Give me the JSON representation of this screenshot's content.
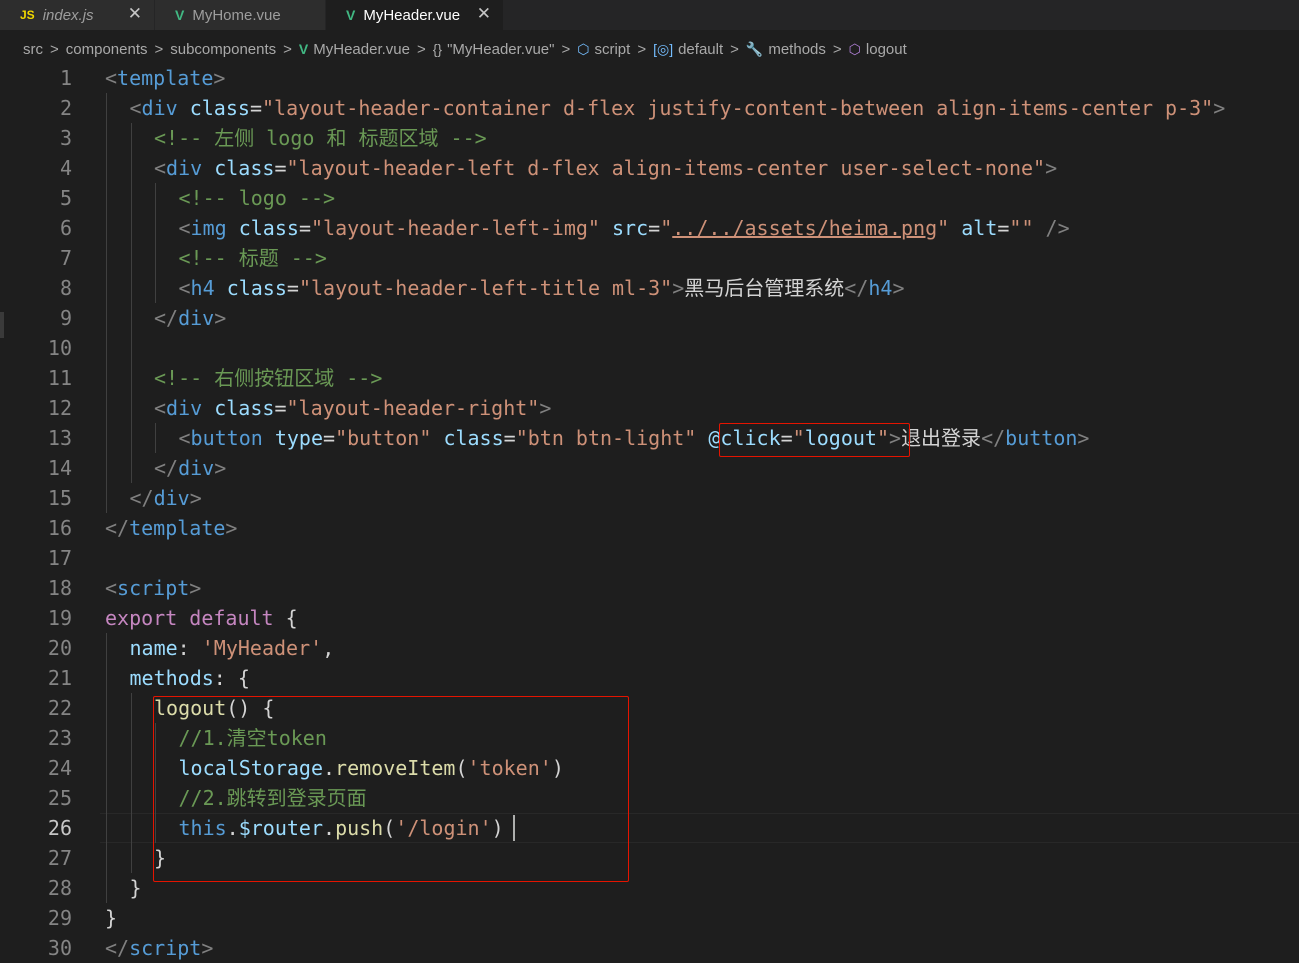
{
  "tabs": [
    {
      "icon": "JS",
      "icon_name": "js-file-icon",
      "label": "index.js",
      "active": false,
      "italic": true,
      "close": "✕"
    },
    {
      "icon": "V",
      "icon_name": "vue-file-icon",
      "label": "MyHome.vue",
      "active": false,
      "italic": false,
      "close": ""
    },
    {
      "icon": "V",
      "icon_name": "vue-file-icon",
      "label": "MyHeader.vue",
      "active": true,
      "italic": false,
      "close": "✕"
    }
  ],
  "breadcrumb": [
    {
      "icon": "",
      "label": "src"
    },
    {
      "icon": "",
      "label": "components"
    },
    {
      "icon": "",
      "label": "subcomponents"
    },
    {
      "icon": "V",
      "icon_name": "vue-file-icon",
      "label": "MyHeader.vue"
    },
    {
      "icon": "{}",
      "icon_name": "braces-icon",
      "label": "\"MyHeader.vue\""
    },
    {
      "icon": "⬡",
      "icon_name": "symbol-module-icon",
      "label": "script"
    },
    {
      "icon": "[◎]",
      "icon_name": "symbol-variable-icon",
      "label": "default"
    },
    {
      "icon": "🔧",
      "icon_name": "symbol-method-icon",
      "label": "methods"
    },
    {
      "icon": "⬡",
      "icon_name": "symbol-method-cube-icon",
      "label": "logout"
    }
  ],
  "breadcrumb_separator": ">",
  "colors": {
    "background": "#1e1e1e",
    "tag": "#569cd6",
    "attribute": "#9cdcfe",
    "string": "#ce9178",
    "comment": "#6a9955",
    "keyword": "#c586c0",
    "function": "#dcdcaa",
    "highlight_box": "#e51400"
  },
  "current_line": 26,
  "lines": [
    {
      "n": "1",
      "indent": 0,
      "tokens": [
        [
          "t-punc",
          "<"
        ],
        [
          "t-tag",
          "template"
        ],
        [
          "t-punc",
          ">"
        ]
      ]
    },
    {
      "n": "2",
      "indent": 1,
      "tokens": [
        [
          "t-punc",
          "<"
        ],
        [
          "t-tag",
          "div"
        ],
        [
          "t-plain",
          " "
        ],
        [
          "t-attr",
          "class"
        ],
        [
          "t-plain",
          "="
        ],
        [
          "t-str",
          "\"layout-header-container d-flex justify-content-between align-items-center p-3\""
        ],
        [
          "t-punc",
          ">"
        ]
      ]
    },
    {
      "n": "3",
      "indent": 2,
      "tokens": [
        [
          "t-cmt",
          "<!-- 左侧 logo 和 标题区域 -->"
        ]
      ]
    },
    {
      "n": "4",
      "indent": 2,
      "tokens": [
        [
          "t-punc",
          "<"
        ],
        [
          "t-tag",
          "div"
        ],
        [
          "t-plain",
          " "
        ],
        [
          "t-attr",
          "class"
        ],
        [
          "t-plain",
          "="
        ],
        [
          "t-str",
          "\"layout-header-left d-flex align-items-center user-select-none\""
        ],
        [
          "t-punc",
          ">"
        ]
      ]
    },
    {
      "n": "5",
      "indent": 3,
      "tokens": [
        [
          "t-cmt",
          "<!-- logo -->"
        ]
      ]
    },
    {
      "n": "6",
      "indent": 3,
      "tokens": [
        [
          "t-punc",
          "<"
        ],
        [
          "t-tag",
          "img"
        ],
        [
          "t-plain",
          " "
        ],
        [
          "t-attr",
          "class"
        ],
        [
          "t-plain",
          "="
        ],
        [
          "t-str",
          "\"layout-header-left-img\""
        ],
        [
          "t-plain",
          " "
        ],
        [
          "t-attr",
          "src"
        ],
        [
          "t-plain",
          "="
        ],
        [
          "t-str",
          "\""
        ],
        [
          "t-str u",
          "../../assets/heima.png"
        ],
        [
          "t-str",
          "\""
        ],
        [
          "t-plain",
          " "
        ],
        [
          "t-attr",
          "alt"
        ],
        [
          "t-plain",
          "="
        ],
        [
          "t-str",
          "\"\""
        ],
        [
          "t-plain",
          " "
        ],
        [
          "t-punc",
          "/>"
        ]
      ]
    },
    {
      "n": "7",
      "indent": 3,
      "tokens": [
        [
          "t-cmt",
          "<!-- 标题 -->"
        ]
      ]
    },
    {
      "n": "8",
      "indent": 3,
      "tokens": [
        [
          "t-punc",
          "<"
        ],
        [
          "t-tag",
          "h4"
        ],
        [
          "t-plain",
          " "
        ],
        [
          "t-attr",
          "class"
        ],
        [
          "t-plain",
          "="
        ],
        [
          "t-str",
          "\"layout-header-left-title ml-3\""
        ],
        [
          "t-punc",
          ">"
        ],
        [
          "t-plain",
          "黑马后台管理系统"
        ],
        [
          "t-punc",
          "</"
        ],
        [
          "t-tag",
          "h4"
        ],
        [
          "t-punc",
          ">"
        ]
      ]
    },
    {
      "n": "9",
      "indent": 2,
      "tokens": [
        [
          "t-punc",
          "</"
        ],
        [
          "t-tag",
          "div"
        ],
        [
          "t-punc",
          ">"
        ]
      ]
    },
    {
      "n": "10",
      "indent": 2,
      "tokens": []
    },
    {
      "n": "11",
      "indent": 2,
      "tokens": [
        [
          "t-cmt",
          "<!-- 右侧按钮区域 -->"
        ]
      ]
    },
    {
      "n": "12",
      "indent": 2,
      "tokens": [
        [
          "t-punc",
          "<"
        ],
        [
          "t-tag",
          "div"
        ],
        [
          "t-plain",
          " "
        ],
        [
          "t-attr",
          "class"
        ],
        [
          "t-plain",
          "="
        ],
        [
          "t-str",
          "\"layout-header-right\""
        ],
        [
          "t-punc",
          ">"
        ]
      ]
    },
    {
      "n": "13",
      "indent": 3,
      "tokens": [
        [
          "t-punc",
          "<"
        ],
        [
          "t-tag",
          "button"
        ],
        [
          "t-plain",
          " "
        ],
        [
          "t-attr",
          "type"
        ],
        [
          "t-plain",
          "="
        ],
        [
          "t-str",
          "\"button\""
        ],
        [
          "t-plain",
          " "
        ],
        [
          "t-attr",
          "class"
        ],
        [
          "t-plain",
          "="
        ],
        [
          "t-str",
          "\"btn btn-light\""
        ],
        [
          "t-plain",
          " "
        ],
        [
          "t-attr",
          "@click"
        ],
        [
          "t-plain",
          "="
        ],
        [
          "t-str",
          "\""
        ],
        [
          "t-attr",
          "logout"
        ],
        [
          "t-str",
          "\""
        ],
        [
          "t-punc",
          ">"
        ],
        [
          "t-plain",
          "退出登录"
        ],
        [
          "t-punc",
          "</"
        ],
        [
          "t-tag",
          "button"
        ],
        [
          "t-punc",
          ">"
        ]
      ]
    },
    {
      "n": "14",
      "indent": 2,
      "tokens": [
        [
          "t-punc",
          "</"
        ],
        [
          "t-tag",
          "div"
        ],
        [
          "t-punc",
          ">"
        ]
      ]
    },
    {
      "n": "15",
      "indent": 1,
      "tokens": [
        [
          "t-punc",
          "</"
        ],
        [
          "t-tag",
          "div"
        ],
        [
          "t-punc",
          ">"
        ]
      ]
    },
    {
      "n": "16",
      "indent": 0,
      "tokens": [
        [
          "t-punc",
          "</"
        ],
        [
          "t-tag",
          "template"
        ],
        [
          "t-punc",
          ">"
        ]
      ]
    },
    {
      "n": "17",
      "indent": 0,
      "tokens": []
    },
    {
      "n": "18",
      "indent": 0,
      "tokens": [
        [
          "t-punc",
          "<"
        ],
        [
          "t-tag",
          "script"
        ],
        [
          "t-punc",
          ">"
        ]
      ]
    },
    {
      "n": "19",
      "indent": 0,
      "tokens": [
        [
          "t-kw",
          "export"
        ],
        [
          "t-plain",
          " "
        ],
        [
          "t-kw",
          "default"
        ],
        [
          "t-plain",
          " {"
        ]
      ]
    },
    {
      "n": "20",
      "indent": 1,
      "tokens": [
        [
          "t-prop",
          "name"
        ],
        [
          "t-plain",
          ": "
        ],
        [
          "t-str",
          "'MyHeader'"
        ],
        [
          "t-plain",
          ","
        ]
      ]
    },
    {
      "n": "21",
      "indent": 1,
      "tokens": [
        [
          "t-prop",
          "methods"
        ],
        [
          "t-plain",
          ": {"
        ]
      ]
    },
    {
      "n": "22",
      "indent": 2,
      "tokens": [
        [
          "t-fn",
          "logout"
        ],
        [
          "t-plain",
          "() {"
        ]
      ]
    },
    {
      "n": "23",
      "indent": 3,
      "tokens": [
        [
          "t-cmt",
          "//1.清空token"
        ]
      ]
    },
    {
      "n": "24",
      "indent": 3,
      "tokens": [
        [
          "t-prop",
          "localStorage"
        ],
        [
          "t-plain",
          "."
        ],
        [
          "t-fn",
          "removeItem"
        ],
        [
          "t-plain",
          "("
        ],
        [
          "t-str",
          "'token'"
        ],
        [
          "t-plain",
          ")"
        ]
      ]
    },
    {
      "n": "25",
      "indent": 3,
      "tokens": [
        [
          "t-cmt",
          "//2.跳转到登录页面"
        ]
      ]
    },
    {
      "n": "26",
      "indent": 3,
      "tokens": [
        [
          "t-this",
          "this"
        ],
        [
          "t-plain",
          "."
        ],
        [
          "t-prop",
          "$router"
        ],
        [
          "t-plain",
          "."
        ],
        [
          "t-fn",
          "push"
        ],
        [
          "t-plain",
          "("
        ],
        [
          "t-str",
          "'/login'"
        ],
        [
          "t-plain",
          ")"
        ]
      ]
    },
    {
      "n": "27",
      "indent": 2,
      "tokens": [
        [
          "t-plain",
          "}"
        ]
      ]
    },
    {
      "n": "28",
      "indent": 1,
      "tokens": [
        [
          "t-plain",
          "}"
        ]
      ]
    },
    {
      "n": "29",
      "indent": 0,
      "tokens": [
        [
          "t-plain",
          "}"
        ]
      ]
    },
    {
      "n": "30",
      "indent": 0,
      "tokens": [
        [
          "t-punc",
          "</"
        ],
        [
          "t-tag",
          "script"
        ],
        [
          "t-punc",
          ">"
        ]
      ]
    }
  ]
}
